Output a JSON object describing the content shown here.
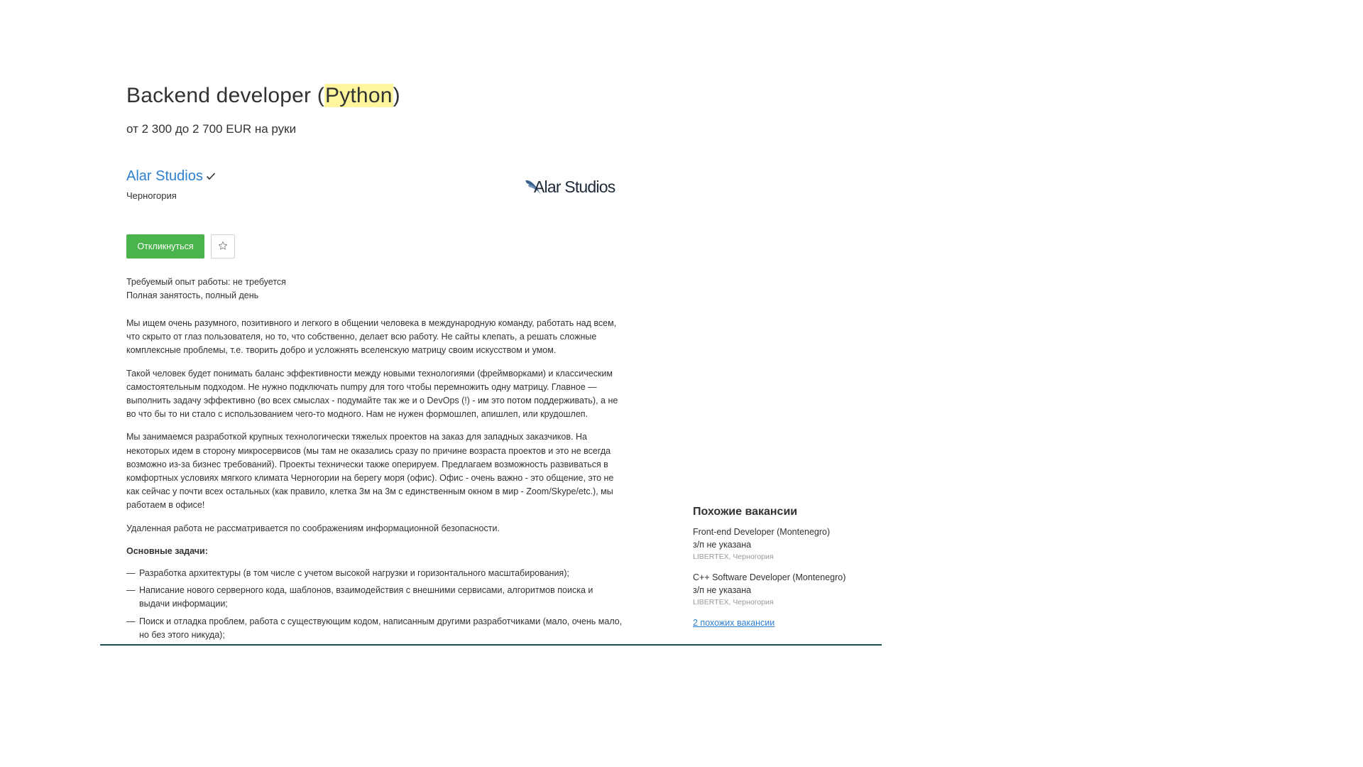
{
  "vacancy": {
    "title_prefix": "Backend developer (",
    "title_highlight": "Python",
    "title_suffix": ")",
    "salary": "от 2 300 до 2 700 EUR на руки",
    "company": "Alar Studios",
    "location": "Черногория",
    "logo_text": "Alar Studios",
    "apply_label": "Откликнуться",
    "experience": "Требуемый опыт работы: не требуется",
    "employment": "Полная занятость, полный день"
  },
  "description": {
    "paragraphs": [
      "Мы ищем очень разумного, позитивного и легкого в общении человека в международную команду, работать над всем, что скрыто от глаз пользователя, но то, что собственно, делает всю работу. Не сайты клепать, а решать сложные комплексные проблемы, т.е. творить добро и усложнять вселенскую матрицу своим искусством и умом.",
      "Такой человек будет понимать баланс эффективности между новыми технологиями (фреймворками) и классическим самостоятельным подходом. Не нужно подключать numpy для того чтобы перемножить одну матрицу. Главное — выполнить задачу эффективно (во всех смыслах - подумайте так же и о DevOps (!) - им это потом поддерживать), а не во что бы то ни стало с использованием чего-то модного. Нам не нужен формошлеп, апишлеп, или крудошлеп.",
      "Мы занимаемся разработкой крупных технологически тяжелых проектов на заказ для западных заказчиков. На некоторых идем в сторону микросервисов (мы там не оказались сразу по причине возраста проектов и это не всегда возможно из-за бизнес требований). Проекты технически также оперируем. Предлагаем возможность развиваться в комфортных условиях мягкого климата Черногории на берегу моря (офис). Офис - очень важно - это общение, это не как сейчас у почти всех остальных (как правило, клетка 3м на 3м с единственным окном в мир - Zoom/Skype/etc.), мы работаем в офисе!",
      "Удаленная работа не рассматривается по соображениям информационной безопасности."
    ],
    "tasks_heading": "Основные задачи:",
    "dash": "—",
    "tasks": [
      "Разработка архитектуры (в том числе с учетом высокой нагрузки и горизонтального масштабирования);",
      "Написание нового серверного кода, шаблонов, взаимодействия с внешними сервисами, алгоритмов поиска и выдачи информации;",
      "Поиск и отладка проблем, работа с существующим кодом, написанным другими разработчиками (мало, очень мало, но без этого никуда);"
    ]
  },
  "similar": {
    "heading": "Похожие вакансии",
    "items": [
      {
        "title": "Front-end Developer (Montenegro)",
        "salary": "з/п не указана",
        "company": "LIBERTEX, Черногория"
      },
      {
        "title": "C++ Software Developer (Montenegro)",
        "salary": "з/п не указана",
        "company": "LIBERTEX, Черногория"
      }
    ],
    "more_link": "2 похожих вакансии"
  },
  "colors": {
    "link": "#2f80d1",
    "apply_button": "#4bb34b",
    "highlight": "#fff59d",
    "bottom_line": "#1e4f57"
  },
  "icons": {
    "verified": "checkmark-icon",
    "favorite": "star-outline-icon"
  }
}
